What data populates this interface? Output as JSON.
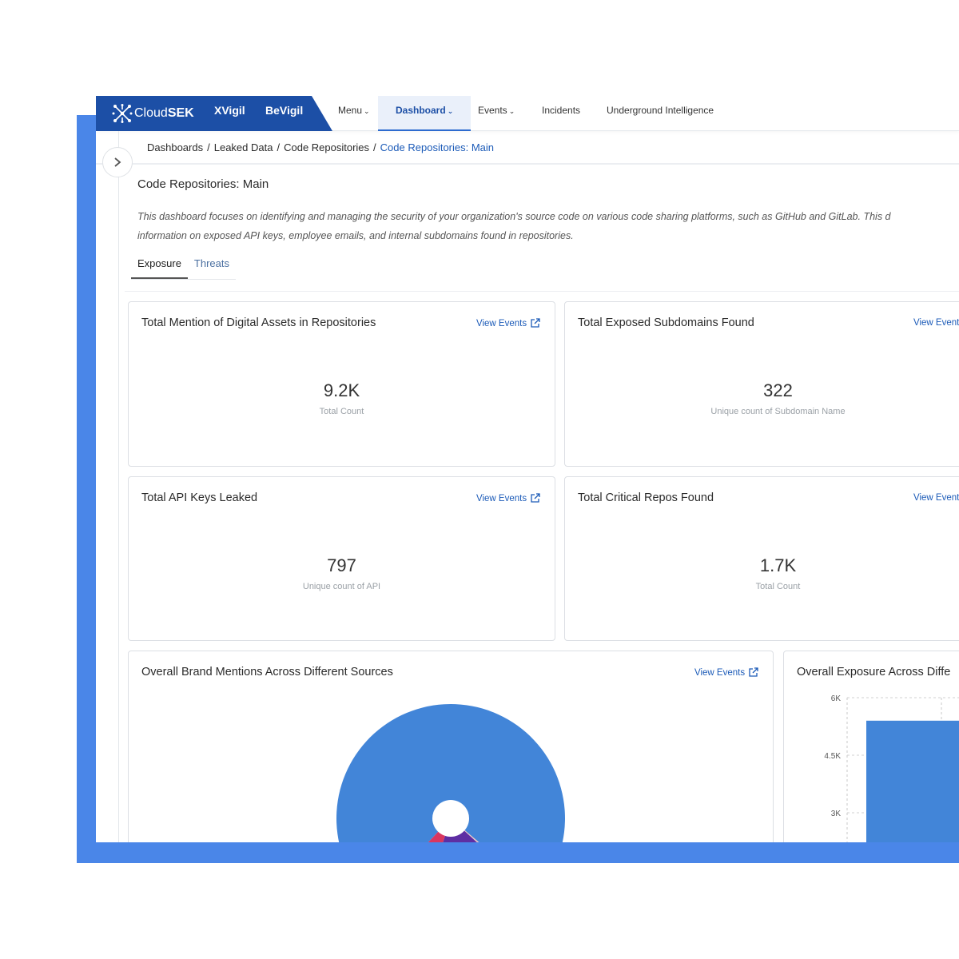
{
  "brand": {
    "logo_cloud": "Cloud",
    "logo_sek": "SEK",
    "product1": "XVigil",
    "product2": "BeVigil"
  },
  "nav": {
    "menu": "Menu",
    "dashboard": "Dashboard",
    "events": "Events",
    "incidents": "Incidents",
    "underground": "Underground Intelligence"
  },
  "breadcrumb": {
    "item1": "Dashboards",
    "item2": "Leaked Data",
    "item3": "Code Repositories",
    "current": "Code Repositories: Main",
    "separator": "/"
  },
  "page": {
    "title": "Code Repositories: Main",
    "description_line1": "This dashboard focuses on identifying and managing the security of your organization's source code on various code sharing platforms, such as GitHub and GitLab. This d",
    "description_line2": "information on exposed API keys, employee emails, and internal subdomains found in repositories."
  },
  "tabs": {
    "exposure": "Exposure",
    "threats": "Threats"
  },
  "view_events_label": "View Events",
  "view_events_truncated": "View Event",
  "cards": {
    "mentions": {
      "title": "Total Mention of Digital Assets in Repositories",
      "value": "9.2K",
      "sub": "Total Count"
    },
    "subdomains": {
      "title": "Total Exposed Subdomains Found",
      "value": "322",
      "sub": "Unique count of Subdomain Name"
    },
    "api_keys": {
      "title": "Total API Keys Leaked",
      "value": "797",
      "sub": "Unique count of API"
    },
    "critical_repos": {
      "title": "Total Critical Repos Found",
      "value": "1.7K",
      "sub": "Total Count"
    },
    "brand_mentions": {
      "title": "Overall Brand Mentions Across Different Sources"
    },
    "exposure": {
      "title": "Overall Exposure Across Diffe"
    }
  },
  "colors": {
    "brand": "#1c4fa6",
    "accent": "#4a86e8",
    "link": "#1c5bb8"
  },
  "chart_data": [
    {
      "type": "pie",
      "title": "Overall Brand Mentions Across Different Sources",
      "slices": [
        {
          "share": 0.742,
          "color": "#4285d8"
        },
        {
          "share": 0.006,
          "color": "#e8c4c4"
        },
        {
          "share": 0.182,
          "color": "#5e2ea3"
        },
        {
          "share": 0.07,
          "color": "#d9365f"
        }
      ]
    },
    {
      "type": "bar",
      "title": "Overall Exposure Across Diffe",
      "ytick_labels": [
        "6K",
        "4.5K",
        "3K"
      ],
      "ylim": [
        0,
        6000
      ],
      "values": [
        5400
      ],
      "color": "#4285d8"
    }
  ]
}
